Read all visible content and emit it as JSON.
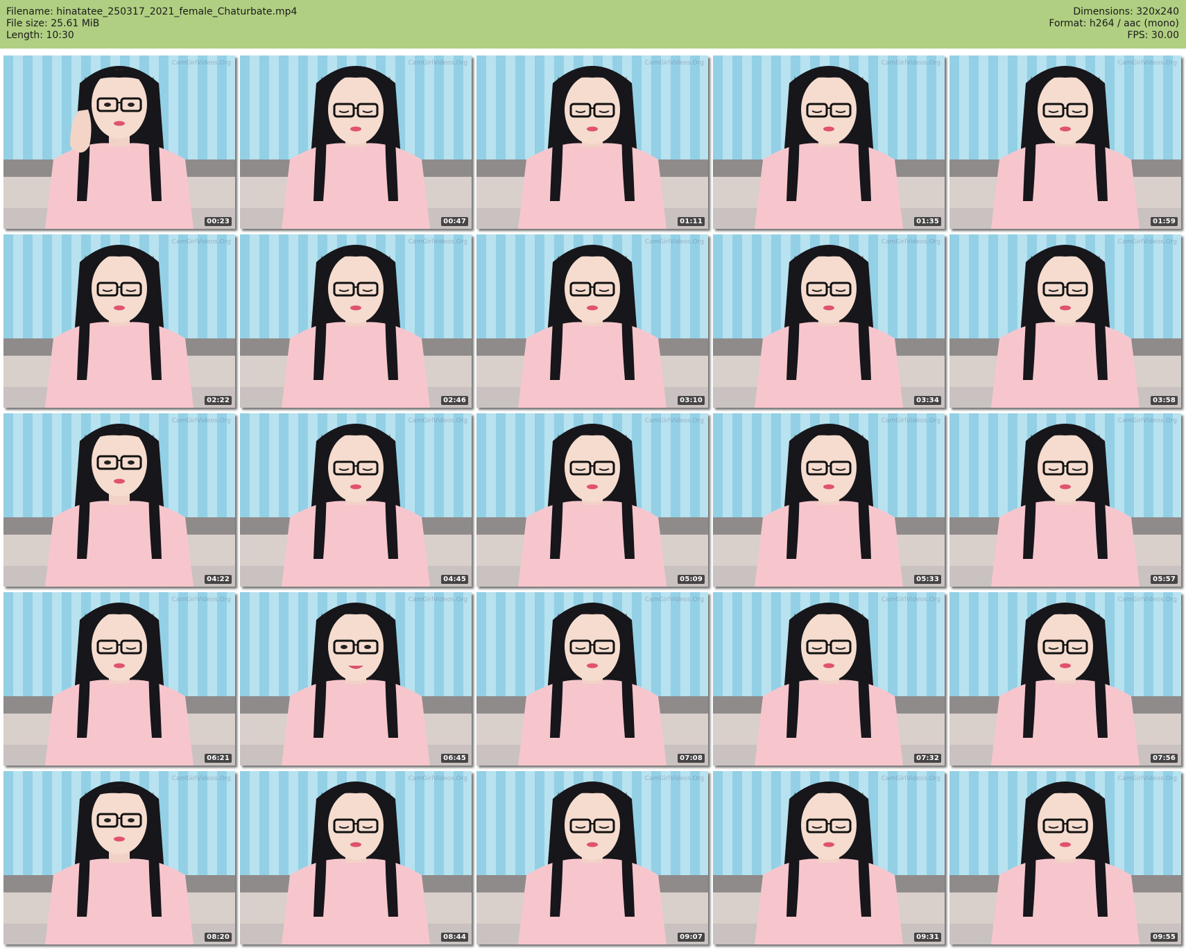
{
  "header": {
    "filename": "Filename: hinatatee_250317_2021_female_Chaturbate.mp4",
    "filesize": "File size: 25.61 MiB",
    "length": "Length: 10:30",
    "dimensions": "Dimensions: 320x240",
    "format": "Format: h264 / aac (mono)",
    "fps": "FPS: 30.00"
  },
  "colors": {
    "header_bg": "#b1cf82",
    "curtain": "#7cc6e0",
    "shirt": "#f7c6cd",
    "hair": "#17161a"
  },
  "thumbnails": [
    {
      "time": "00:23",
      "pose": "hand-up"
    },
    {
      "time": "00:47",
      "pose": "down"
    },
    {
      "time": "01:11",
      "pose": "down"
    },
    {
      "time": "01:35",
      "pose": "down"
    },
    {
      "time": "01:59",
      "pose": "down"
    },
    {
      "time": "02:22",
      "pose": "down"
    },
    {
      "time": "02:46",
      "pose": "down"
    },
    {
      "time": "03:10",
      "pose": "down"
    },
    {
      "time": "03:34",
      "pose": "down"
    },
    {
      "time": "03:58",
      "pose": "down"
    },
    {
      "time": "04:22",
      "pose": "up"
    },
    {
      "time": "04:45",
      "pose": "down"
    },
    {
      "time": "05:09",
      "pose": "down"
    },
    {
      "time": "05:33",
      "pose": "down"
    },
    {
      "time": "05:57",
      "pose": "down"
    },
    {
      "time": "06:21",
      "pose": "down"
    },
    {
      "time": "06:45",
      "pose": "smile"
    },
    {
      "time": "07:08",
      "pose": "down"
    },
    {
      "time": "07:32",
      "pose": "down"
    },
    {
      "time": "07:56",
      "pose": "down"
    },
    {
      "time": "08:20",
      "pose": "up"
    },
    {
      "time": "08:44",
      "pose": "down"
    },
    {
      "time": "09:07",
      "pose": "down"
    },
    {
      "time": "09:31",
      "pose": "down"
    },
    {
      "time": "09:55",
      "pose": "down"
    }
  ],
  "watermark": "CamGirlVideos.Org"
}
